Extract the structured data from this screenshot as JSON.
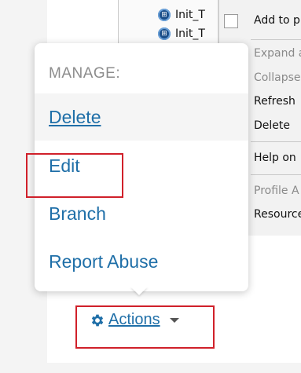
{
  "background": {
    "tree_items": [
      {
        "label": "Init_T",
        "icon": "uml-component-icon"
      },
      {
        "label": "Init_T",
        "icon": "uml-component-icon"
      }
    ],
    "context_menu": [
      {
        "label": "Add to p",
        "disabled": false
      },
      {
        "label": "Expand a",
        "disabled": true
      },
      {
        "label": "Collapse",
        "disabled": true
      },
      {
        "label": "Refresh",
        "disabled": false
      },
      {
        "label": "Delete",
        "disabled": false
      },
      {
        "label": "Help on",
        "disabled": false
      },
      {
        "label": "Profile A",
        "disabled": true
      },
      {
        "label": "Resource",
        "disabled": false
      }
    ]
  },
  "menu": {
    "header": "MANAGE:",
    "items": [
      "Delete",
      "Edit",
      "Branch",
      "Report Abuse"
    ]
  },
  "actions": {
    "label": "Actions",
    "icon": "gear-icon"
  },
  "colors": {
    "link": "#1f6fa8",
    "annotation": "#d0202a"
  }
}
